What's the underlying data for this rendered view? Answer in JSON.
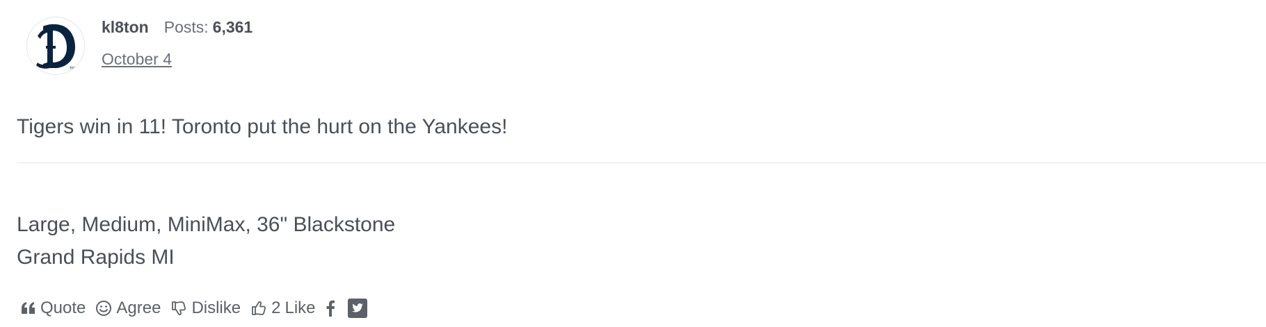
{
  "author": {
    "username": "kl8ton",
    "avatar_icon": "detroit-tigers-logo",
    "posts_label": "Posts:",
    "posts_count": "6,361",
    "date": "October 4"
  },
  "post": {
    "body": "Tigers win in 11! Toronto put the hurt on the Yankees!"
  },
  "signature": {
    "lines": [
      "Large, Medium, MiniMax, 36\" Blackstone",
      "Grand Rapids MI"
    ]
  },
  "actions": {
    "quote_label": "Quote",
    "agree_label": "Agree",
    "dislike_label": "Dislike",
    "like_count": "2",
    "like_label": "Like",
    "share_icons": [
      "facebook-icon",
      "twitter-icon"
    ]
  },
  "colors": {
    "text": "#4a4f57",
    "muted": "#6b7078",
    "divider": "#e4e6e9",
    "logo": "#0c2340"
  }
}
